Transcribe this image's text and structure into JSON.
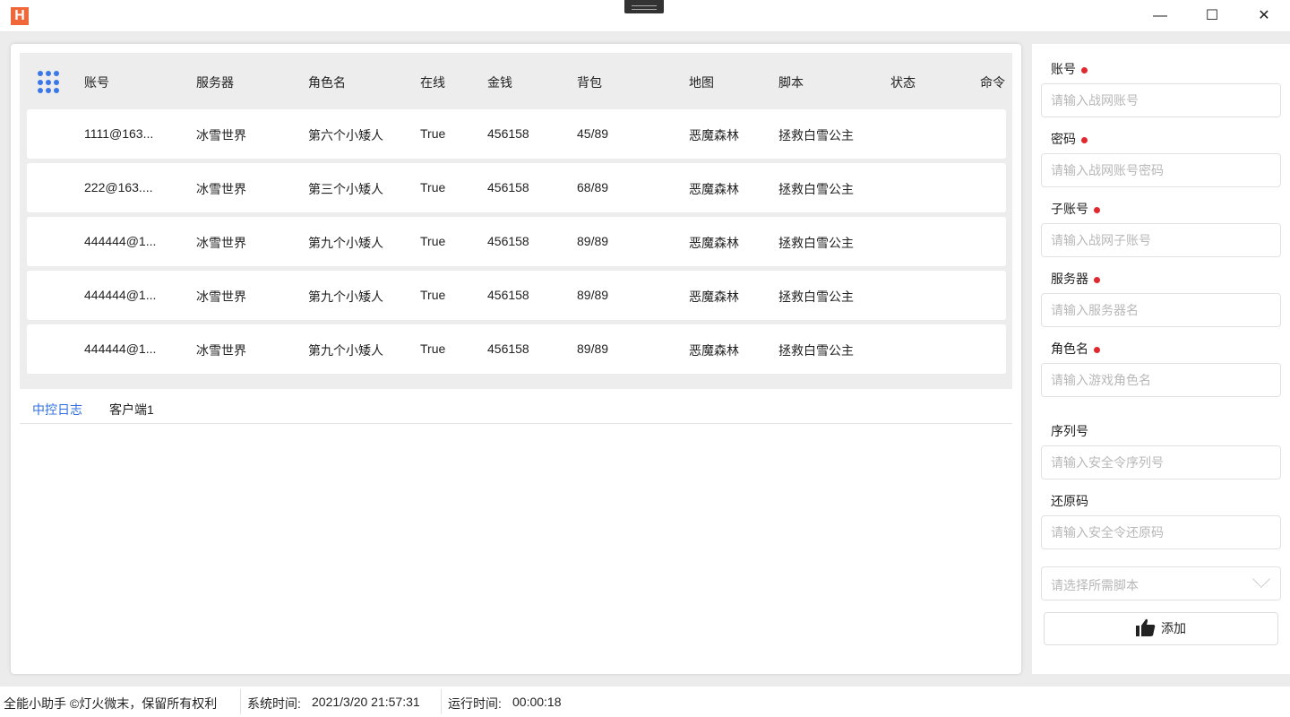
{
  "window": {
    "logo": "H",
    "minimize": "—",
    "maximize": "☐",
    "close": "✕"
  },
  "table": {
    "headers": [
      "账号",
      "服务器",
      "角色名",
      "在线",
      "金钱",
      "背包",
      "地图",
      "脚本",
      "状态",
      "命令"
    ],
    "rows": [
      [
        "1111@163...",
        "冰雪世界",
        "第六个小矮人",
        "True",
        "456158",
        "45/89",
        "恶魔森林",
        "拯救白雪公主"
      ],
      [
        "222@163....",
        "冰雪世界",
        "第三个小矮人",
        "True",
        "456158",
        "68/89",
        "恶魔森林",
        "拯救白雪公主"
      ],
      [
        "444444@1...",
        "冰雪世界",
        "第九个小矮人",
        "True",
        "456158",
        "89/89",
        "恶魔森林",
        "拯救白雪公主"
      ],
      [
        "444444@1...",
        "冰雪世界",
        "第九个小矮人",
        "True",
        "456158",
        "89/89",
        "恶魔森林",
        "拯救白雪公主"
      ],
      [
        "444444@1...",
        "冰雪世界",
        "第九个小矮人",
        "True",
        "456158",
        "89/89",
        "恶魔森林",
        "拯救白雪公主"
      ]
    ]
  },
  "tabs": [
    {
      "label": "中控日志",
      "active": true
    },
    {
      "label": "客户端1",
      "active": false
    }
  ],
  "form": {
    "fields": [
      {
        "label": "账号",
        "required": true,
        "placeholder": "请输入战网账号"
      },
      {
        "label": "密码",
        "required": true,
        "placeholder": "请输入战网账号密码"
      },
      {
        "label": "子账号",
        "required": true,
        "placeholder": "请输入战网子账号"
      },
      {
        "label": "服务器",
        "required": true,
        "placeholder": "请输入服务器名"
      },
      {
        "label": "角色名",
        "required": true,
        "placeholder": "请输入游戏角色名"
      },
      {
        "label": "序列号",
        "required": false,
        "placeholder": "请输入安全令序列号"
      },
      {
        "label": "还原码",
        "required": false,
        "placeholder": "请输入安全令还原码"
      }
    ],
    "script_select": "请选择所需脚本",
    "add_button": "添加"
  },
  "status": {
    "copyright": "全能小助手 ©灯火微末，保留所有权利",
    "system_time_label": "系统时间:",
    "system_time": "2021/3/20 21:57:31",
    "run_time_label": "运行时间:",
    "run_time": "00:00:18"
  },
  "colors": {
    "accent": "#3b78e7",
    "required": "#e0282e",
    "logo": "#f0683a"
  }
}
